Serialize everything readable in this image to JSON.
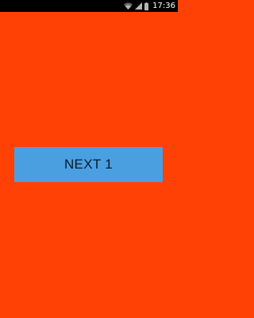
{
  "status_bar": {
    "time": "17:36",
    "icons": [
      "wifi-icon",
      "signal-icon",
      "battery-icon"
    ]
  },
  "main": {
    "next_button_label": "NEXT 1"
  },
  "colors": {
    "background": "#FF4105",
    "button": "#4A9FE0",
    "button_text": "#0B1A2A",
    "status_bar": "#000000"
  }
}
